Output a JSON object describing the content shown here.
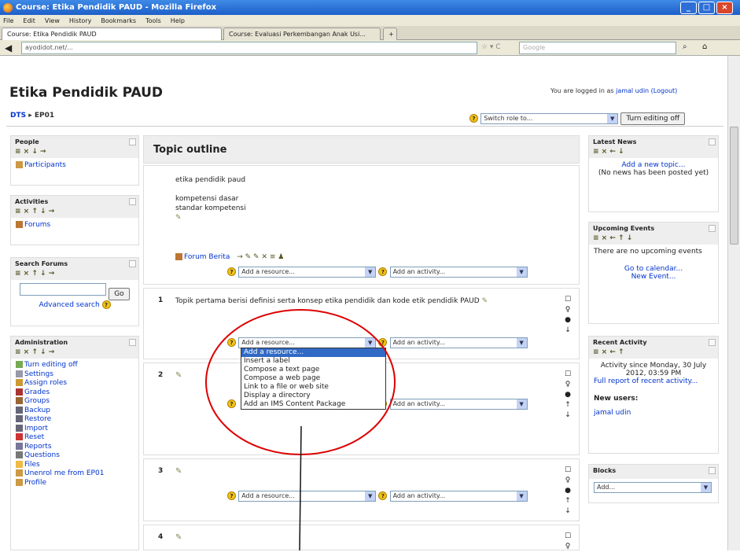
{
  "browser": {
    "title": "Course: Etika Pendidik PAUD - Mozilla Firefox",
    "menu": [
      "File",
      "Edit",
      "View",
      "History",
      "Bookmarks",
      "Tools",
      "Help"
    ],
    "tabs": [
      "Course: Etika Pendidik PAUD",
      "Course: Evaluasi Perkembangan Anak Usi..."
    ],
    "url": "ayodidot.net/...",
    "search_placeholder": "Google"
  },
  "page": {
    "site_title": "Etika Pendidik PAUD",
    "logged_in_prefix": "You are logged in as",
    "user": "jamal udin",
    "logout": "(Logout)",
    "breadcrumb": [
      "DTS",
      "EP01"
    ],
    "switch_role": "Switch role to...",
    "turn_editing_off": "Turn editing off"
  },
  "left": {
    "people": {
      "title": "People",
      "tools": "≡ × ↓ →",
      "items": [
        "Participants"
      ]
    },
    "activities": {
      "title": "Activities",
      "tools": "≡ × ↑ ↓ →",
      "items": [
        "Forums"
      ]
    },
    "search": {
      "title": "Search Forums",
      "tools": "≡ × ↑ ↓ →",
      "go": "Go",
      "advanced": "Advanced search"
    },
    "admin": {
      "title": "Administration",
      "tools": "≡ × ↑ ↓ →",
      "items": [
        "Turn editing off",
        "Settings",
        "Assign roles",
        "Grades",
        "Groups",
        "Backup",
        "Restore",
        "Import",
        "Reset",
        "Reports",
        "Questions",
        "Files",
        "Unenrol me from EP01",
        "Profile"
      ]
    }
  },
  "center": {
    "title": "Topic outline",
    "intro": [
      "etika pendidik paud",
      "kompetensi dasar",
      "standar kompetensi"
    ],
    "forum": "Forum Berita",
    "add_resource": "Add a resource...",
    "add_activity": "Add an activity...",
    "topic1": "Topik pertama berisi definisi serta konsep etika pendidik dan kode etik pendidik PAUD",
    "topic_numbers": [
      "1",
      "2",
      "3",
      "4"
    ],
    "dropdown": [
      "Add a resource...",
      "Insert a label",
      "Compose a text page",
      "Compose a web page",
      "Link to a file or web site",
      "Display a directory",
      "Add an IMS Content Package"
    ]
  },
  "right": {
    "news": {
      "title": "Latest News",
      "tools": "≡ × ← ↓",
      "add": "Add a new topic...",
      "none": "(No news has been posted yet)"
    },
    "events": {
      "title": "Upcoming Events",
      "tools": "≡ × ← ↑ ↓",
      "none": "There are no upcoming events",
      "calendar": "Go to calendar...",
      "new_event": "New Event..."
    },
    "recent": {
      "title": "Recent Activity",
      "tools": "≡ × ← ↑",
      "since": "Activity since Monday, 30 July 2012, 03:59 PM",
      "full": "Full report of recent activity...",
      "new_users": "New users:",
      "user": "jamal udin"
    },
    "blocks": {
      "title": "Blocks",
      "add": "Add..."
    }
  },
  "colors": {
    "annotation": "#dd0000",
    "link": "#0033cc",
    "titlebar": "#2a6fd8"
  }
}
